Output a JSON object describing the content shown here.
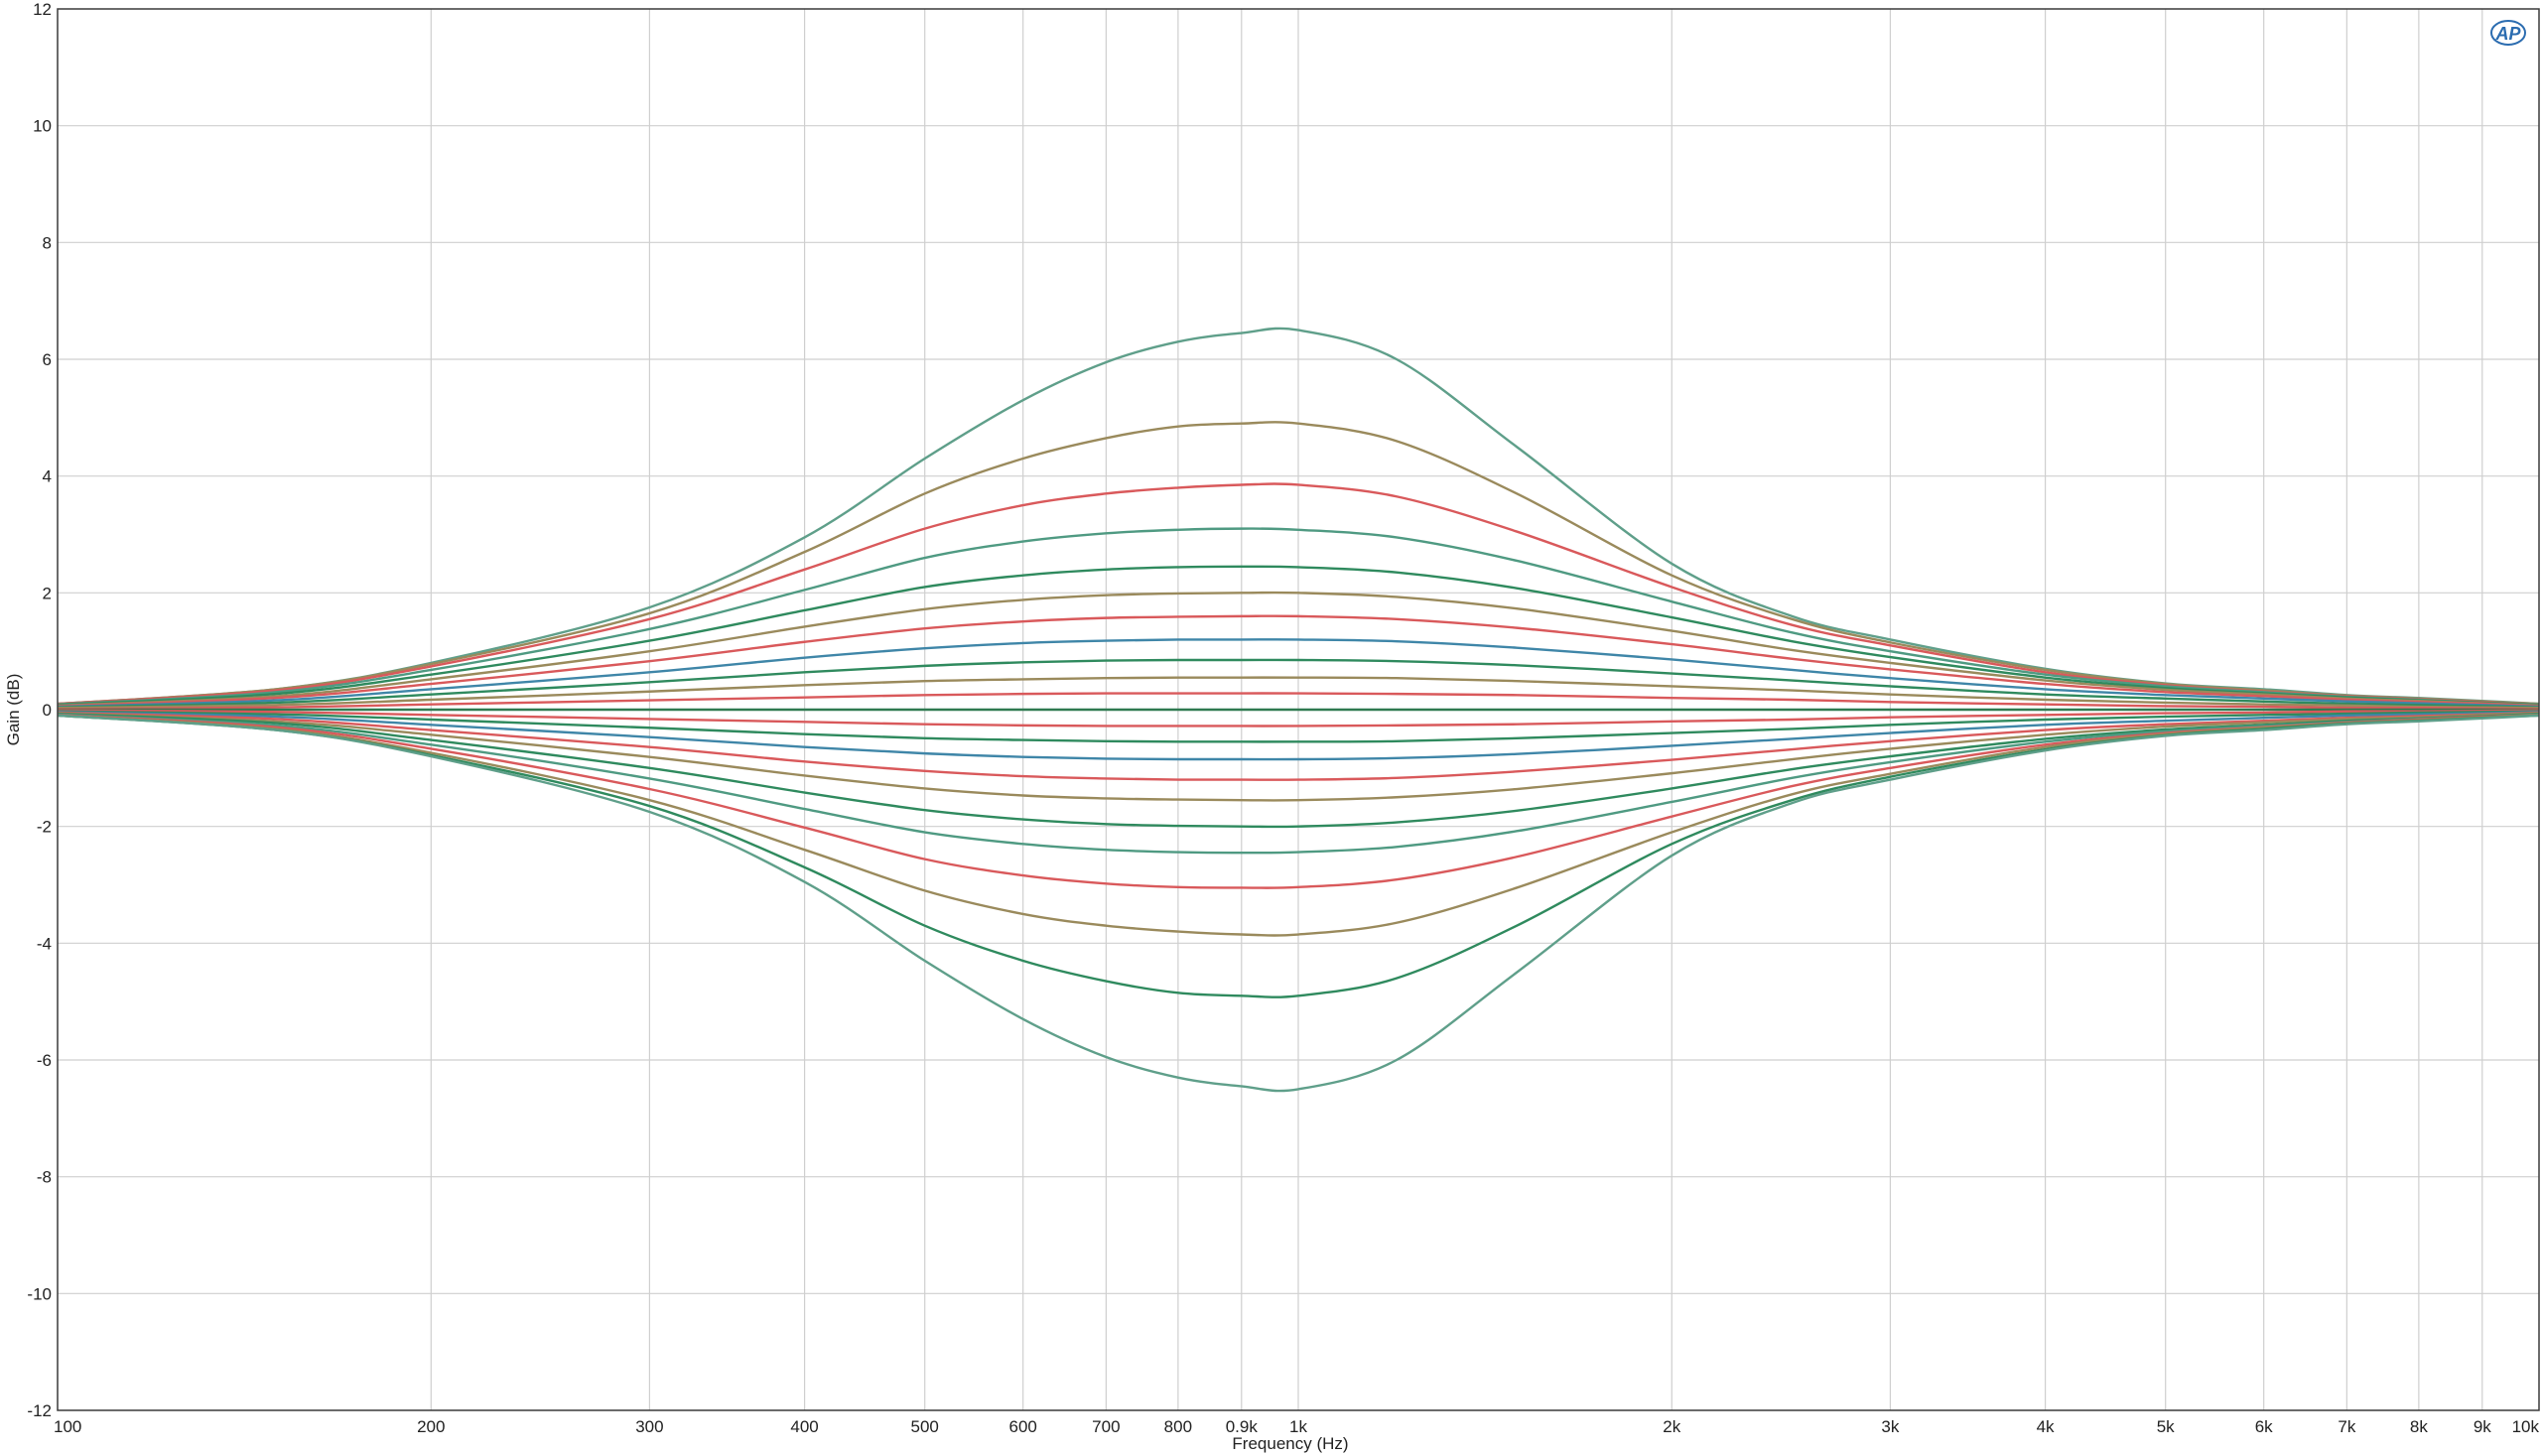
{
  "chart_data": {
    "type": "line",
    "xlabel": "Frequency (Hz)",
    "ylabel": "Gain (dB)",
    "xscale": "log",
    "xlim": [
      100,
      10000
    ],
    "ylim": [
      -12,
      12
    ],
    "grid": true,
    "x_ticks": [
      {
        "value": 100,
        "label": "100"
      },
      {
        "value": 200,
        "label": "200"
      },
      {
        "value": 300,
        "label": "300"
      },
      {
        "value": 400,
        "label": "400"
      },
      {
        "value": 500,
        "label": "500"
      },
      {
        "value": 600,
        "label": "600"
      },
      {
        "value": 700,
        "label": "700"
      },
      {
        "value": 800,
        "label": "800"
      },
      {
        "value": 900,
        "label": "0.9k"
      },
      {
        "value": 1000,
        "label": "1k"
      },
      {
        "value": 2000,
        "label": "2k"
      },
      {
        "value": 3000,
        "label": "3k"
      },
      {
        "value": 4000,
        "label": "4k"
      },
      {
        "value": 5000,
        "label": "5k"
      },
      {
        "value": 6000,
        "label": "6k"
      },
      {
        "value": 7000,
        "label": "7k"
      },
      {
        "value": 8000,
        "label": "8k"
      },
      {
        "value": 9000,
        "label": "9k"
      },
      {
        "value": 10000,
        "label": "10k"
      }
    ],
    "y_ticks": [
      {
        "value": 12,
        "label": "12"
      },
      {
        "value": 10,
        "label": "10"
      },
      {
        "value": 8,
        "label": "8"
      },
      {
        "value": 6,
        "label": "6"
      },
      {
        "value": 4,
        "label": "4"
      },
      {
        "value": 2,
        "label": "2"
      },
      {
        "value": 0,
        "label": "0"
      },
      {
        "value": -2,
        "label": "-2"
      },
      {
        "value": -4,
        "label": "-4"
      },
      {
        "value": -6,
        "label": "-6"
      },
      {
        "value": -8,
        "label": "-8"
      },
      {
        "value": -10,
        "label": "-10"
      },
      {
        "value": -12,
        "label": "-12"
      }
    ],
    "x": [
      100,
      150,
      200,
      300,
      400,
      500,
      600,
      700,
      800,
      900,
      1000,
      1200,
      1500,
      2000,
      2500,
      3000,
      4000,
      5000,
      6000,
      7000,
      8000,
      9000,
      10000
    ],
    "series": [
      {
        "peak_gain_db": 6.5,
        "color": "#5f9f8a",
        "values": [
          0.1,
          0.35,
          0.8,
          1.75,
          2.95,
          4.3,
          5.3,
          5.95,
          6.3,
          6.45,
          6.5,
          6.0,
          4.5,
          2.5,
          1.6,
          1.2,
          0.7,
          0.45,
          0.35,
          0.25,
          0.2,
          0.15,
          0.1
        ]
      },
      {
        "peak_gain_db": 4.9,
        "color": "#9a8a5c",
        "values": [
          0.1,
          0.35,
          0.78,
          1.65,
          2.7,
          3.7,
          4.3,
          4.65,
          4.85,
          4.9,
          4.9,
          4.6,
          3.7,
          2.3,
          1.55,
          1.15,
          0.68,
          0.44,
          0.33,
          0.24,
          0.19,
          0.14,
          0.1
        ]
      },
      {
        "peak_gain_db": 3.85,
        "color": "#d9595b",
        "values": [
          0.1,
          0.33,
          0.74,
          1.55,
          2.4,
          3.1,
          3.5,
          3.7,
          3.8,
          3.85,
          3.85,
          3.65,
          3.05,
          2.1,
          1.45,
          1.1,
          0.64,
          0.42,
          0.31,
          0.23,
          0.18,
          0.13,
          0.09
        ]
      },
      {
        "peak_gain_db": 3.1,
        "color": "#4f9a82",
        "values": [
          0.09,
          0.3,
          0.68,
          1.38,
          2.05,
          2.6,
          2.88,
          3.02,
          3.08,
          3.1,
          3.08,
          2.95,
          2.55,
          1.85,
          1.32,
          1.0,
          0.6,
          0.4,
          0.3,
          0.22,
          0.17,
          0.12,
          0.09
        ]
      },
      {
        "peak_gain_db": 2.45,
        "color": "#2f8a5e",
        "values": [
          0.08,
          0.27,
          0.6,
          1.18,
          1.7,
          2.1,
          2.3,
          2.4,
          2.44,
          2.45,
          2.44,
          2.35,
          2.08,
          1.58,
          1.17,
          0.9,
          0.55,
          0.37,
          0.28,
          0.21,
          0.16,
          0.12,
          0.08
        ]
      },
      {
        "peak_gain_db": 2.0,
        "color": "#9a8a5c",
        "values": [
          0.07,
          0.23,
          0.52,
          1.0,
          1.42,
          1.72,
          1.88,
          1.96,
          1.99,
          2.0,
          2.0,
          1.93,
          1.73,
          1.35,
          1.02,
          0.8,
          0.5,
          0.34,
          0.26,
          0.19,
          0.15,
          0.11,
          0.07
        ]
      },
      {
        "peak_gain_db": 1.6,
        "color": "#d9595b",
        "values": [
          0.06,
          0.2,
          0.44,
          0.83,
          1.16,
          1.39,
          1.51,
          1.57,
          1.59,
          1.6,
          1.6,
          1.55,
          1.4,
          1.12,
          0.87,
          0.69,
          0.44,
          0.3,
          0.23,
          0.17,
          0.13,
          0.1,
          0.06
        ]
      },
      {
        "peak_gain_db": 1.2,
        "color": "#3f86a8",
        "values": [
          0.05,
          0.16,
          0.35,
          0.64,
          0.89,
          1.05,
          1.14,
          1.18,
          1.2,
          1.2,
          1.2,
          1.17,
          1.06,
          0.86,
          0.68,
          0.54,
          0.35,
          0.25,
          0.19,
          0.14,
          0.11,
          0.08,
          0.05
        ]
      },
      {
        "peak_gain_db": 0.85,
        "color": "#2f8a5e",
        "values": [
          0.04,
          0.12,
          0.26,
          0.47,
          0.64,
          0.75,
          0.81,
          0.84,
          0.85,
          0.85,
          0.85,
          0.83,
          0.76,
          0.62,
          0.5,
          0.4,
          0.26,
          0.19,
          0.14,
          0.1,
          0.08,
          0.06,
          0.04
        ]
      },
      {
        "peak_gain_db": 0.55,
        "color": "#9a8a5c",
        "values": [
          0.03,
          0.08,
          0.17,
          0.31,
          0.42,
          0.49,
          0.52,
          0.54,
          0.55,
          0.55,
          0.55,
          0.54,
          0.49,
          0.4,
          0.33,
          0.26,
          0.17,
          0.12,
          0.09,
          0.07,
          0.05,
          0.04,
          0.03
        ]
      },
      {
        "peak_gain_db": 0.28,
        "color": "#d9595b",
        "values": [
          0.01,
          0.04,
          0.09,
          0.16,
          0.21,
          0.25,
          0.27,
          0.28,
          0.28,
          0.28,
          0.28,
          0.27,
          0.25,
          0.2,
          0.17,
          0.13,
          0.09,
          0.06,
          0.05,
          0.03,
          0.03,
          0.02,
          0.01
        ]
      },
      {
        "peak_gain_db": 0.0,
        "color": "#2f7a50",
        "values": [
          0,
          0,
          0,
          0,
          0,
          0,
          0,
          0,
          0,
          0,
          0,
          0,
          0,
          0,
          0,
          0,
          0,
          0,
          0,
          0,
          0,
          0,
          0
        ]
      },
      {
        "peak_gain_db": -0.28,
        "color": "#d9595b",
        "values": [
          -0.01,
          -0.04,
          -0.09,
          -0.16,
          -0.21,
          -0.25,
          -0.27,
          -0.28,
          -0.28,
          -0.28,
          -0.28,
          -0.27,
          -0.25,
          -0.2,
          -0.17,
          -0.13,
          -0.09,
          -0.06,
          -0.05,
          -0.03,
          -0.03,
          -0.02,
          -0.01
        ]
      },
      {
        "peak_gain_db": -0.55,
        "color": "#2f8a5e",
        "values": [
          -0.03,
          -0.08,
          -0.17,
          -0.31,
          -0.42,
          -0.49,
          -0.52,
          -0.54,
          -0.55,
          -0.55,
          -0.55,
          -0.54,
          -0.49,
          -0.4,
          -0.33,
          -0.26,
          -0.17,
          -0.12,
          -0.09,
          -0.07,
          -0.05,
          -0.04,
          -0.03
        ]
      },
      {
        "peak_gain_db": -0.85,
        "color": "#3f86a8",
        "values": [
          -0.04,
          -0.12,
          -0.26,
          -0.47,
          -0.64,
          -0.75,
          -0.81,
          -0.84,
          -0.85,
          -0.85,
          -0.85,
          -0.83,
          -0.76,
          -0.62,
          -0.5,
          -0.4,
          -0.26,
          -0.19,
          -0.14,
          -0.1,
          -0.08,
          -0.06,
          -0.04
        ]
      },
      {
        "peak_gain_db": -1.2,
        "color": "#d9595b",
        "values": [
          -0.05,
          -0.16,
          -0.35,
          -0.64,
          -0.89,
          -1.05,
          -1.14,
          -1.18,
          -1.2,
          -1.2,
          -1.2,
          -1.17,
          -1.06,
          -0.86,
          -0.68,
          -0.54,
          -0.35,
          -0.25,
          -0.19,
          -0.14,
          -0.11,
          -0.08,
          -0.05
        ]
      },
      {
        "peak_gain_db": -1.55,
        "color": "#9a8a5c",
        "values": [
          -0.06,
          -0.2,
          -0.43,
          -0.81,
          -1.13,
          -1.35,
          -1.47,
          -1.52,
          -1.54,
          -1.55,
          -1.55,
          -1.5,
          -1.36,
          -1.09,
          -0.85,
          -0.67,
          -0.43,
          -0.29,
          -0.22,
          -0.16,
          -0.13,
          -0.09,
          -0.06
        ]
      },
      {
        "peak_gain_db": -2.0,
        "color": "#2f8a5e",
        "values": [
          -0.07,
          -0.23,
          -0.52,
          -1.0,
          -1.42,
          -1.72,
          -1.88,
          -1.96,
          -1.99,
          -2.0,
          -2.0,
          -1.93,
          -1.73,
          -1.35,
          -1.02,
          -0.8,
          -0.5,
          -0.34,
          -0.26,
          -0.19,
          -0.15,
          -0.11,
          -0.07
        ]
      },
      {
        "peak_gain_db": -2.45,
        "color": "#4f9a82",
        "values": [
          -0.08,
          -0.27,
          -0.6,
          -1.18,
          -1.7,
          -2.1,
          -2.3,
          -2.4,
          -2.44,
          -2.45,
          -2.44,
          -2.35,
          -2.08,
          -1.58,
          -1.17,
          -0.9,
          -0.55,
          -0.37,
          -0.28,
          -0.21,
          -0.16,
          -0.12,
          -0.08
        ]
      },
      {
        "peak_gain_db": -3.05,
        "color": "#d9595b",
        "values": [
          -0.09,
          -0.3,
          -0.67,
          -1.36,
          -2.02,
          -2.56,
          -2.84,
          -2.98,
          -3.04,
          -3.05,
          -3.04,
          -2.91,
          -2.52,
          -1.83,
          -1.31,
          -1.0,
          -0.6,
          -0.4,
          -0.3,
          -0.22,
          -0.17,
          -0.12,
          -0.09
        ]
      },
      {
        "peak_gain_db": -3.85,
        "color": "#9a8a5c",
        "values": [
          -0.1,
          -0.33,
          -0.74,
          -1.55,
          -2.4,
          -3.1,
          -3.5,
          -3.7,
          -3.8,
          -3.85,
          -3.85,
          -3.65,
          -3.05,
          -2.1,
          -1.45,
          -1.1,
          -0.64,
          -0.42,
          -0.31,
          -0.23,
          -0.18,
          -0.13,
          -0.09
        ]
      },
      {
        "peak_gain_db": -4.9,
        "color": "#2f8a5e",
        "values": [
          -0.1,
          -0.35,
          -0.78,
          -1.65,
          -2.7,
          -3.7,
          -4.3,
          -4.65,
          -4.85,
          -4.9,
          -4.9,
          -4.6,
          -3.7,
          -2.3,
          -1.55,
          -1.15,
          -0.68,
          -0.44,
          -0.33,
          -0.24,
          -0.19,
          -0.14,
          -0.1
        ]
      },
      {
        "peak_gain_db": -6.5,
        "color": "#5f9f8a",
        "values": [
          -0.1,
          -0.35,
          -0.8,
          -1.75,
          -2.95,
          -4.3,
          -5.3,
          -5.95,
          -6.3,
          -6.45,
          -6.5,
          -6.0,
          -4.5,
          -2.5,
          -1.6,
          -1.2,
          -0.7,
          -0.45,
          -0.35,
          -0.25,
          -0.2,
          -0.15,
          -0.1
        ]
      }
    ]
  },
  "logo_text": "AP",
  "colors": {
    "grid": "#cfcfcf",
    "frame": "#3a3a3a",
    "logo": "#2b6cb0"
  }
}
